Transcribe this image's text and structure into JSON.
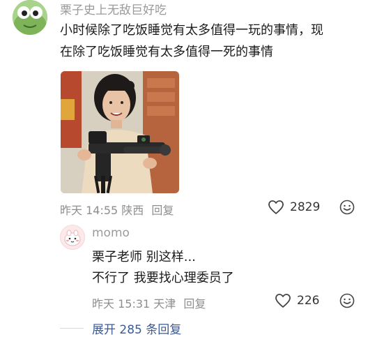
{
  "comment": {
    "username": "栗子史上无敌巨好吃",
    "text_line1": "小时候除了吃饭睡觉有太多值得一玩的事情，现",
    "text_line2": "在除了吃饭睡觉有太多值得一死的事情",
    "time": "昨天 14:55",
    "location": "陕西",
    "reply_label": "回复",
    "likes": "2829"
  },
  "reply": {
    "username": "momo",
    "text_line1": "栗子老师 别这样...",
    "text_line2": "不行了 我要找心理委员了",
    "time": "昨天 15:31",
    "location": "天津",
    "reply_label": "回复",
    "likes": "226"
  },
  "expand_label": "展开 285 条回复",
  "colors": {
    "username": "#9a9a9a",
    "meta": "#8e8e8e",
    "expand_link": "#3a5a96"
  },
  "icons": {
    "like": "heart-outline-icon",
    "emoji": "smiley-face-icon"
  }
}
